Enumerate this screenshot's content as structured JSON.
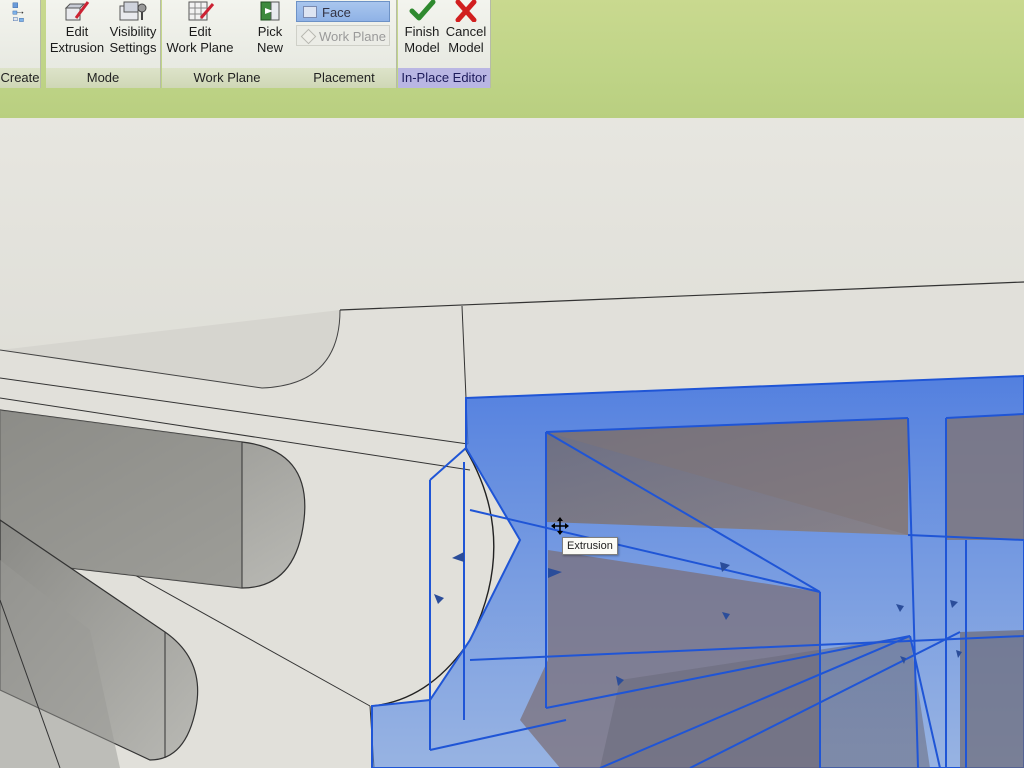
{
  "ribbon": {
    "panels": {
      "create": "Create",
      "mode": "Mode",
      "work_plane": "Work Plane",
      "placement": "Placement",
      "in_place_editor": "In-Place Editor"
    },
    "buttons": {
      "edit_extrusion": "Edit\nExtrusion",
      "visibility_settings": "Visibility\nSettings",
      "edit_work_plane": "Edit\nWork Plane",
      "pick_new": "Pick\nNew",
      "finish_model": "Finish\nModel",
      "cancel_model": "Cancel\nModel"
    },
    "placement_options": {
      "face": "Face",
      "work_plane": "Work Plane"
    }
  },
  "viewport": {
    "tooltip": "Extrusion"
  },
  "colors": {
    "ribbon_bg": "#bfd487",
    "selection_blue": "#2d63d6",
    "in_place_editor": "#b9b6e3",
    "finish_check": "#2f8a2f",
    "cancel_x": "#d11f1f"
  }
}
